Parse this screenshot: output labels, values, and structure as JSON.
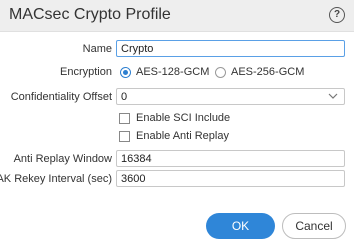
{
  "dialog": {
    "title": "MACsec Crypto Profile",
    "help_icon": "question-circle-icon"
  },
  "form": {
    "name": {
      "label": "Name",
      "value": "Crypto"
    },
    "encryption": {
      "label": "Encryption",
      "options": [
        {
          "label": "AES-128-GCM",
          "selected": true
        },
        {
          "label": "AES-256-GCM",
          "selected": false
        }
      ]
    },
    "confidentiality_offset": {
      "label": "Confidentiality Offset",
      "value": "0"
    },
    "enable_sci_include": {
      "label": "Enable SCI Include",
      "checked": false
    },
    "enable_anti_replay": {
      "label": "Enable Anti Replay",
      "checked": false
    },
    "anti_replay_window": {
      "label": "Anti Replay Window",
      "value": "16384"
    },
    "sak_rekey_interval": {
      "label": "SAK Rekey Interval (sec)",
      "value": "3600"
    }
  },
  "buttons": {
    "ok": "OK",
    "cancel": "Cancel"
  },
  "colors": {
    "primary": "#2f86d8",
    "focus_border": "#5aa0e6",
    "header_bg": "#eeeeee"
  }
}
